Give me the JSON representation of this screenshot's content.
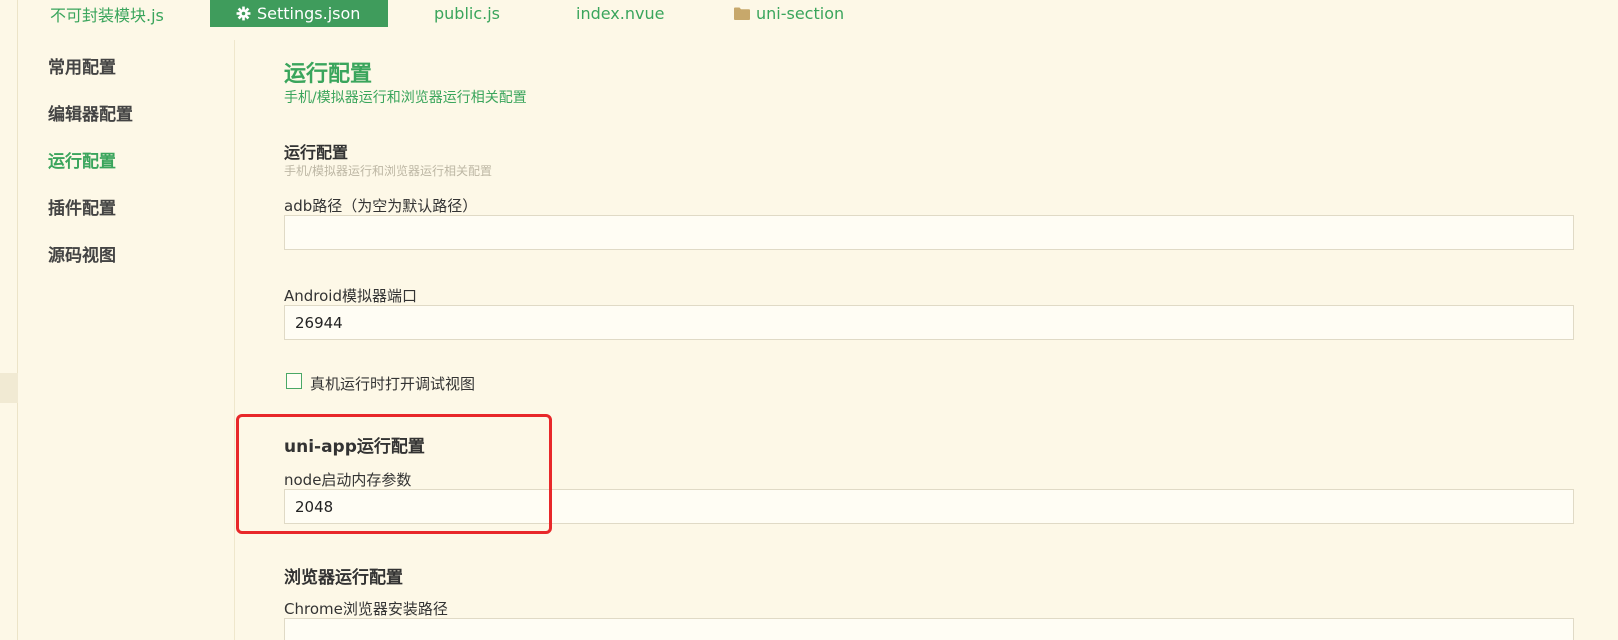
{
  "tabs": [
    {
      "label": "不可封装模块.js",
      "icon": "none",
      "active": false
    },
    {
      "label": "Settings.json",
      "icon": "gear-icon",
      "active": true
    },
    {
      "label": "public.js",
      "icon": "none",
      "active": false
    },
    {
      "label": "index.nvue",
      "icon": "none",
      "active": false
    },
    {
      "label": "uni-section",
      "icon": "folder-icon",
      "active": false
    }
  ],
  "sidebar": {
    "items": [
      {
        "label": "常用配置",
        "active": false
      },
      {
        "label": "编辑器配置",
        "active": false
      },
      {
        "label": "运行配置",
        "active": true
      },
      {
        "label": "插件配置",
        "active": false
      },
      {
        "label": "源码视图",
        "active": false
      }
    ]
  },
  "main": {
    "title": "运行配置",
    "subtitle": "手机/模拟器运行和浏览器运行相关配置",
    "run_section": {
      "title": "运行配置",
      "subtitle": "手机/模拟器运行和浏览器运行相关配置",
      "adb_label": "adb路径（为空为默认路径）",
      "adb_value": "",
      "android_port_label": "Android模拟器端口",
      "android_port_value": "26944",
      "debug_view_checkbox_label": "真机运行时打开调试视图",
      "debug_view_checked": false
    },
    "uniapp_section": {
      "title": "uni-app运行配置",
      "node_memory_label": "node启动内存参数",
      "node_memory_value": "2048"
    },
    "browser_section": {
      "title": "浏览器运行配置",
      "chrome_path_label": "Chrome浏览器安装路径"
    }
  },
  "colors": {
    "accent": "#3aa55c",
    "tab_active_bg": "#3f9c5c",
    "background": "#fdf8e7",
    "highlight": "#e8282a"
  }
}
